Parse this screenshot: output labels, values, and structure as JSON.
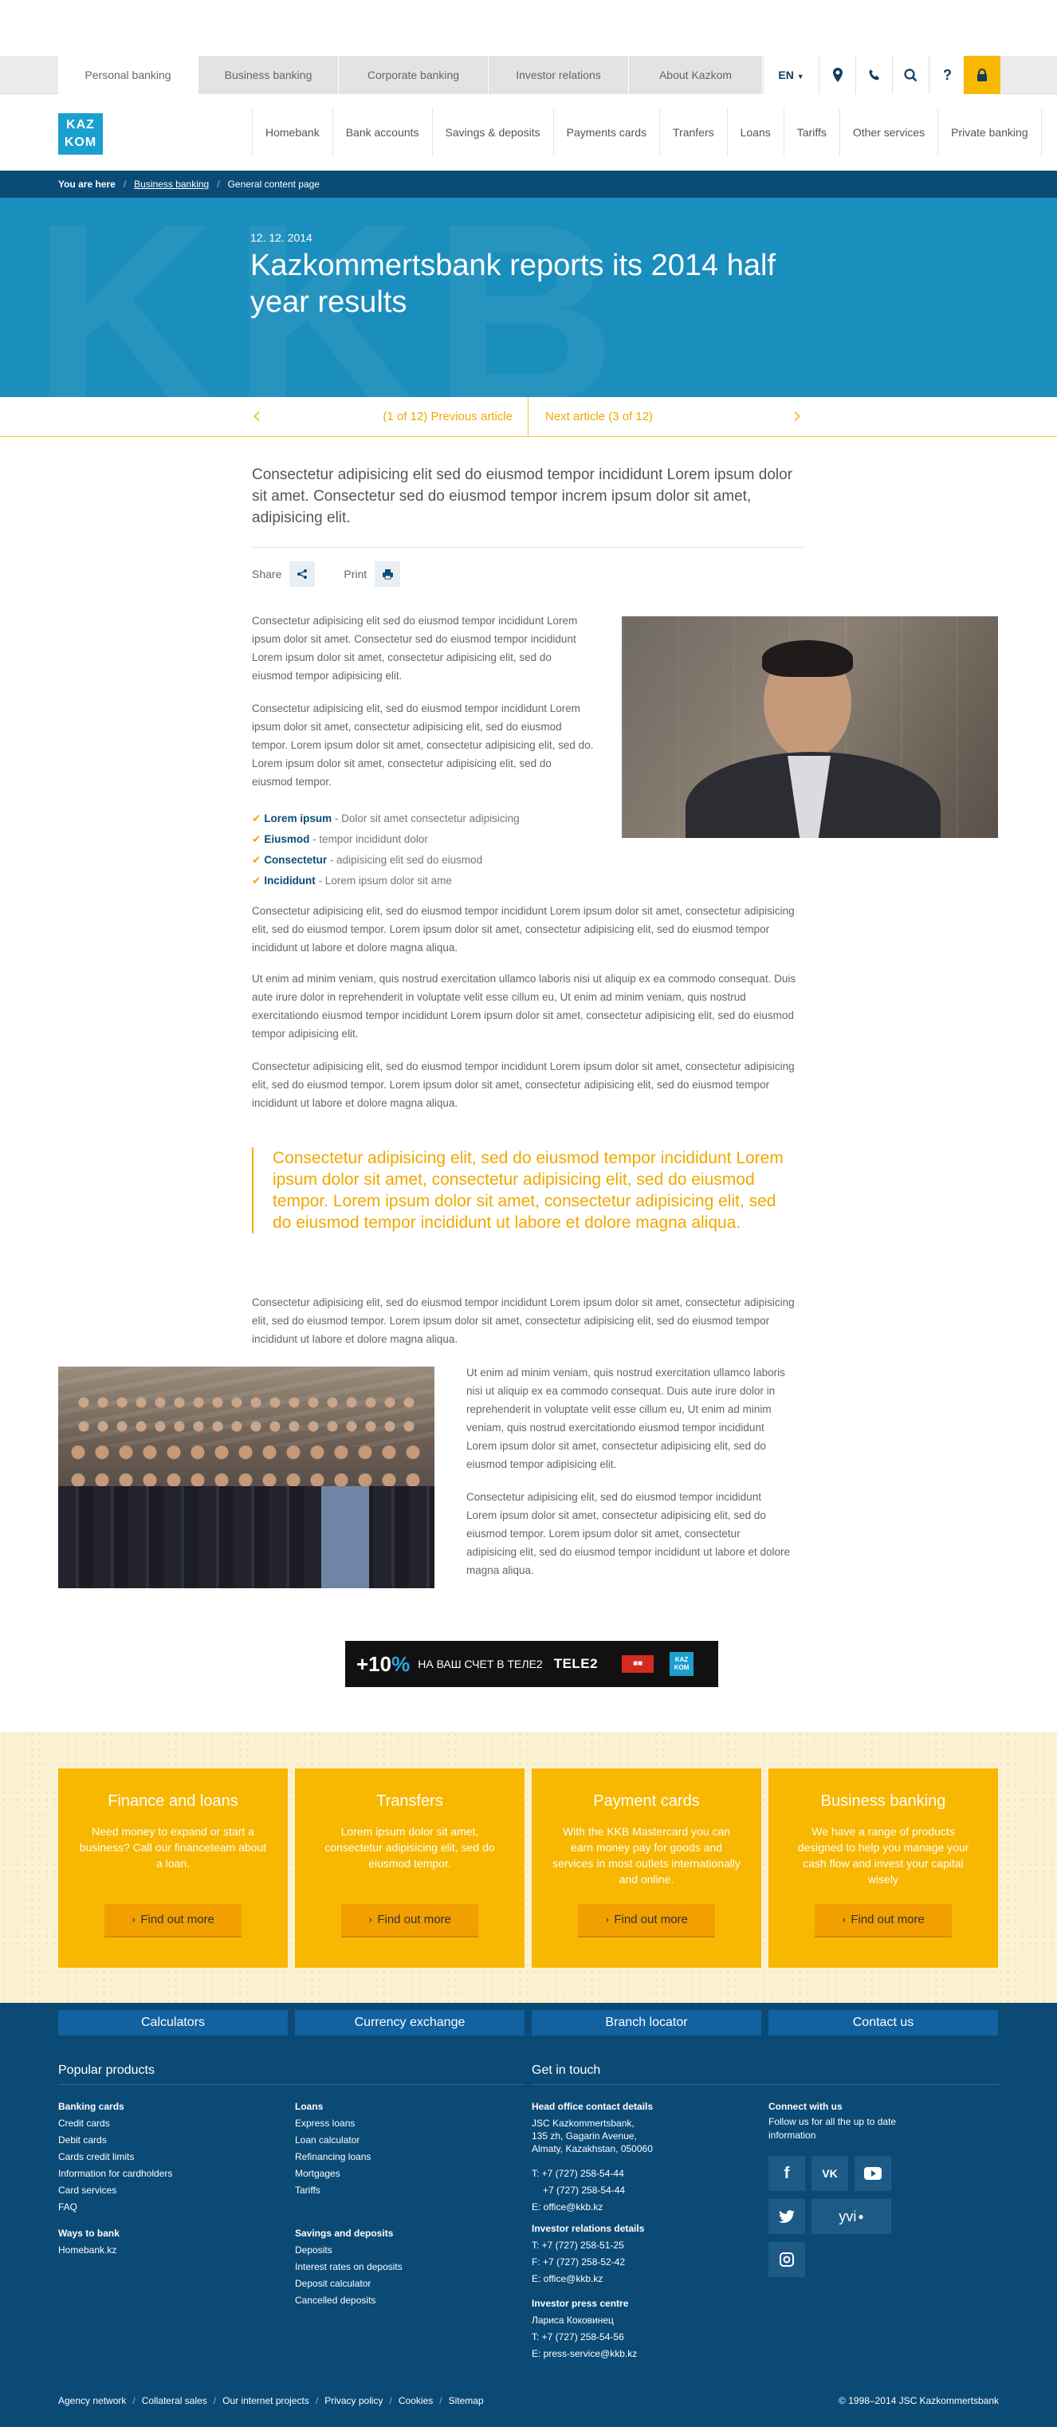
{
  "top_tabs": [
    "Personal banking",
    "Business banking",
    "Corporate banking",
    "Investor relations",
    "About Kazkom"
  ],
  "language": "EN",
  "logo": {
    "line1": "KAZ",
    "line2": "KOM"
  },
  "main_nav": [
    "Homebank",
    "Bank accounts",
    "Savings & deposits",
    "Payments cards",
    "Tranfers",
    "Loans",
    "Tariffs",
    "Other services",
    "Private banking"
  ],
  "breadcrumb": {
    "label": "You are here",
    "items": [
      "Business banking",
      "General content page"
    ]
  },
  "hero": {
    "date": "12. 12. 2014",
    "title": "Kazkommertsbank reports its 2014 half year results"
  },
  "article_nav": {
    "prev": "(1 of 12)  Previous article",
    "next": "Next article  (3 of 12)"
  },
  "lead": "Consectetur adipisicing elit sed do eiusmod tempor incididunt Lorem ipsum dolor sit amet. Consectetur sed do eiusmod tempor increm ipsum dolor sit amet, adipisicing elit.",
  "share_label": "Share",
  "print_label": "Print",
  "paragraphs": {
    "p1": "Consectetur adipisicing elit sed do eiusmod tempor incididunt Lorem ipsum dolor sit amet. Consectetur sed do eiusmod tempor incididunt Lorem ipsum dolor sit amet, consectetur adipisicing elit, sed do eiusmod tempor adipisicing elit.",
    "p2": "Consectetur adipisicing elit, sed do eiusmod tempor incididunt Lorem ipsum dolor sit amet, consectetur adipisicing elit, sed do eiusmod tempor. Lorem ipsum dolor sit amet, consectetur adipisicing elit, sed do. Lorem ipsum dolor sit amet, consectetur adipisicing elit, sed do eiusmod tempor.",
    "p3": "Consectetur adipisicing elit, sed do eiusmod tempor incididunt Lorem ipsum dolor sit amet, consectetur adipisicing elit, sed do eiusmod tempor. Lorem ipsum dolor sit amet, consectetur adipisicing elit, sed do eiusmod tempor incididunt ut labore et dolore magna aliqua.",
    "p4": "Ut enim ad minim veniam, quis nostrud exercitation ullamco laboris nisi ut aliquip ex ea commodo consequat. Duis aute irure dolor in reprehenderit in voluptate velit esse cillum eu, Ut enim ad minim veniam, quis nostrud exercitationdo eiusmod tempor incididunt Lorem ipsum dolor sit amet, consectetur adipisicing elit, sed do eiusmod tempor adipisicing elit.",
    "p5": "Consectetur adipisicing elit, sed do eiusmod tempor incididunt Lorem ipsum dolor sit amet, consectetur adipisicing elit, sed do eiusmod tempor. Lorem ipsum dolor sit amet, consectetur adipisicing elit, sed do eiusmod tempor incididunt ut labore et dolore magna aliqua.",
    "p6": "Consectetur adipisicing elit, sed do eiusmod tempor incididunt Lorem ipsum dolor sit amet, consectetur adipisicing elit, sed do eiusmod tempor. Lorem ipsum dolor sit amet, consectetur adipisicing elit, sed do eiusmod tempor incididunt ut labore et dolore magna aliqua.",
    "p7": "Ut enim ad minim veniam, quis nostrud exercitation ullamco laboris nisi ut aliquip ex ea commodo consequat. Duis aute irure dolor in reprehenderit in voluptate velit esse cillum eu, Ut enim ad minim veniam, quis nostrud exercitationdo eiusmod tempor incididunt Lorem ipsum dolor sit amet, consectetur adipisicing elit, sed do eiusmod tempor adipisicing elit.",
    "p8": "Consectetur adipisicing elit, sed do eiusmod tempor incididunt Lorem ipsum dolor sit amet, consectetur adipisicing elit, sed do eiusmod tempor. Lorem ipsum dolor sit amet, consectetur adipisicing elit, sed do eiusmod tempor incididunt ut labore et dolore magna aliqua."
  },
  "checklist": [
    {
      "term": "Lorem ipsum",
      "text": " - Dolor sit amet consectetur adipisicing"
    },
    {
      "term": "Eiusmod",
      "text": " - tempor incididunt dolor"
    },
    {
      "term": "Consectetur",
      "text": " - adipisicing elit sed do eiusmod"
    },
    {
      "term": "Incididunt",
      "text": " - Lorem ipsum dolor sit ame"
    }
  ],
  "quote": "Consectetur adipisicing elit, sed do eiusmod tempor incididunt Lorem ipsum dolor sit amet, consectetur adipisicing elit, sed do eiusmod tempor. Lorem ipsum dolor sit amet, consectetur adipisicing elit, sed do eiusmod tempor incididunt ut labore et dolore magna aliqua.",
  "banner": {
    "percent": "+10",
    "pct_sign": "%",
    "text": "НА ВАШ СЧЕТ В ТЕЛЕ2",
    "brand": "TELE2"
  },
  "promo_cards": [
    {
      "title": "Finance and loans",
      "text": "Need money to expand or start a business? Call our financeteam about a loan.",
      "button": "Find out more"
    },
    {
      "title": "Transfers",
      "text": "Lorem ipsum dolor sit amet, consectetur adipisicing elit, sed do eiusmod tempor.",
      "button": "Find out more"
    },
    {
      "title": "Payment cards",
      "text": "With the KKB Mastercard you can earn money pay for goods and services in most outlets internationally and online.",
      "button": "Find out more"
    },
    {
      "title": "Business banking",
      "text": "We have a range of products designed to help you manage your cash flow and invest your capital wisely",
      "button": "Find out more"
    }
  ],
  "footer": {
    "buttons": [
      "Calculators",
      "Currency exchange",
      "Branch locator",
      "Contact us"
    ],
    "popular_title": "Popular products",
    "contact_title": "Get in touch",
    "banking_cards": {
      "title": "Banking cards",
      "items": [
        "Credit cards",
        "Debit cards",
        "Cards credit limits",
        "Information for cardholders",
        "Card services",
        "FAQ"
      ]
    },
    "ways": {
      "title": "Ways to bank",
      "items": [
        "Homebank.kz"
      ]
    },
    "loans": {
      "title": "Loans",
      "items": [
        "Express loans",
        "Loan calculator",
        "Refinancing loans",
        "Mortgages",
        "Tariffs"
      ]
    },
    "savings": {
      "title": "Savings and deposits",
      "items": [
        "Deposits",
        "Interest rates on deposits",
        "Deposit calculator",
        "Cancelled deposits"
      ]
    },
    "head_office": {
      "title": "Head office contact details",
      "lines": [
        "JSC Kazkommertsbank,",
        "135 zh, Gagarin Avenue,",
        "Almaty, Kazakhstan, 050060"
      ],
      "t1": "T: +7 (727) 258-54-44",
      "t2": "+7 (727) 258-54-44",
      "email": "E: office@kkb.kz"
    },
    "investor": {
      "title": "Investor relations details",
      "t": "T: +7 (727) 258-51-25",
      "f": "F: +7 (727) 258-52-42",
      "e": "E: office@kkb.kz"
    },
    "press": {
      "title": "Investor press centre",
      "name": "Лариса Коковинец",
      "t": "T: +7 (727) 258-54-56",
      "e": "E: press-service@kkb.kz"
    },
    "connect": {
      "title": "Connect with us",
      "text": "Follow us for all the up to date information"
    },
    "social_yvi": "yvi",
    "bottom_links": [
      "Agency network",
      "Collateral sales",
      "Our internet projects",
      "Privacy policy",
      "Cookies",
      "Sitemap"
    ],
    "copyright": "© 1998–2014 JSC Kazkommertsbank"
  },
  "colors": {
    "brand_blue": "#0b4c77",
    "accent_blue": "#1a8ebd",
    "accent_yellow": "#f8b700"
  }
}
